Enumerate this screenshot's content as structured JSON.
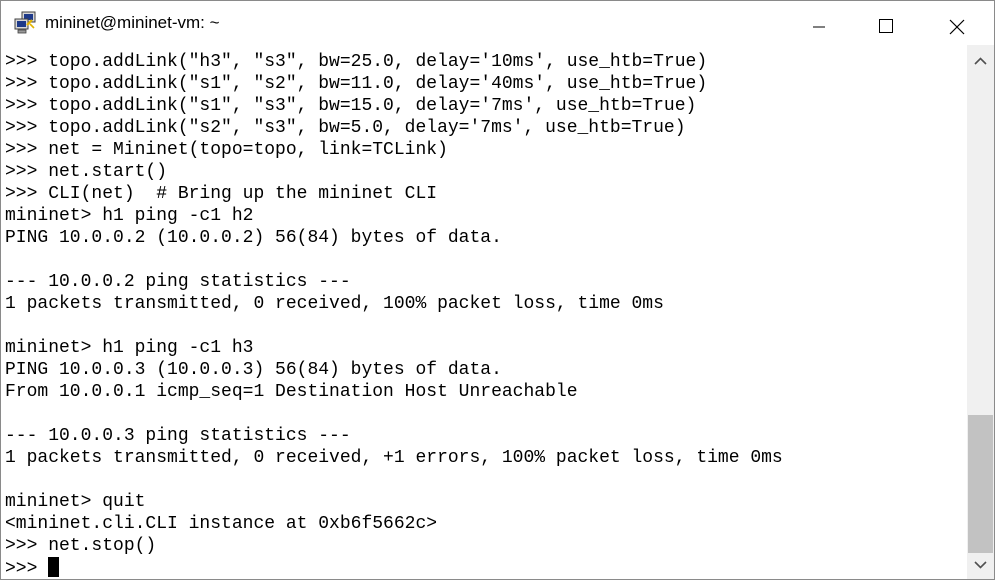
{
  "window": {
    "title": "mininet@mininet-vm: ~",
    "icon": "putty-icon",
    "controls": [
      "minimize-icon",
      "maximize-icon",
      "close-icon"
    ]
  },
  "terminal": {
    "lines": [
      ">>> topo.addLink(\"h3\", \"s3\", bw=25.0, delay='10ms', use_htb=True)",
      ">>> topo.addLink(\"s1\", \"s2\", bw=11.0, delay='40ms', use_htb=True)",
      ">>> topo.addLink(\"s1\", \"s3\", bw=15.0, delay='7ms', use_htb=True)",
      ">>> topo.addLink(\"s2\", \"s3\", bw=5.0, delay='7ms', use_htb=True)",
      ">>> net = Mininet(topo=topo, link=TCLink)",
      ">>> net.start()",
      ">>> CLI(net)  # Bring up the mininet CLI",
      "mininet> h1 ping -c1 h2",
      "PING 10.0.0.2 (10.0.0.2) 56(84) bytes of data.",
      "",
      "--- 10.0.0.2 ping statistics ---",
      "1 packets transmitted, 0 received, 100% packet loss, time 0ms",
      "",
      "mininet> h1 ping -c1 h3",
      "PING 10.0.0.3 (10.0.0.3) 56(84) bytes of data.",
      "From 10.0.0.1 icmp_seq=1 Destination Host Unreachable",
      "",
      "--- 10.0.0.3 ping statistics ---",
      "1 packets transmitted, 0 received, +1 errors, 100% packet loss, time 0ms",
      "",
      "mininet> quit",
      "<mininet.cli.CLI instance at 0xb6f5662c>",
      ">>> net.stop()"
    ],
    "prompt": ">>> "
  }
}
